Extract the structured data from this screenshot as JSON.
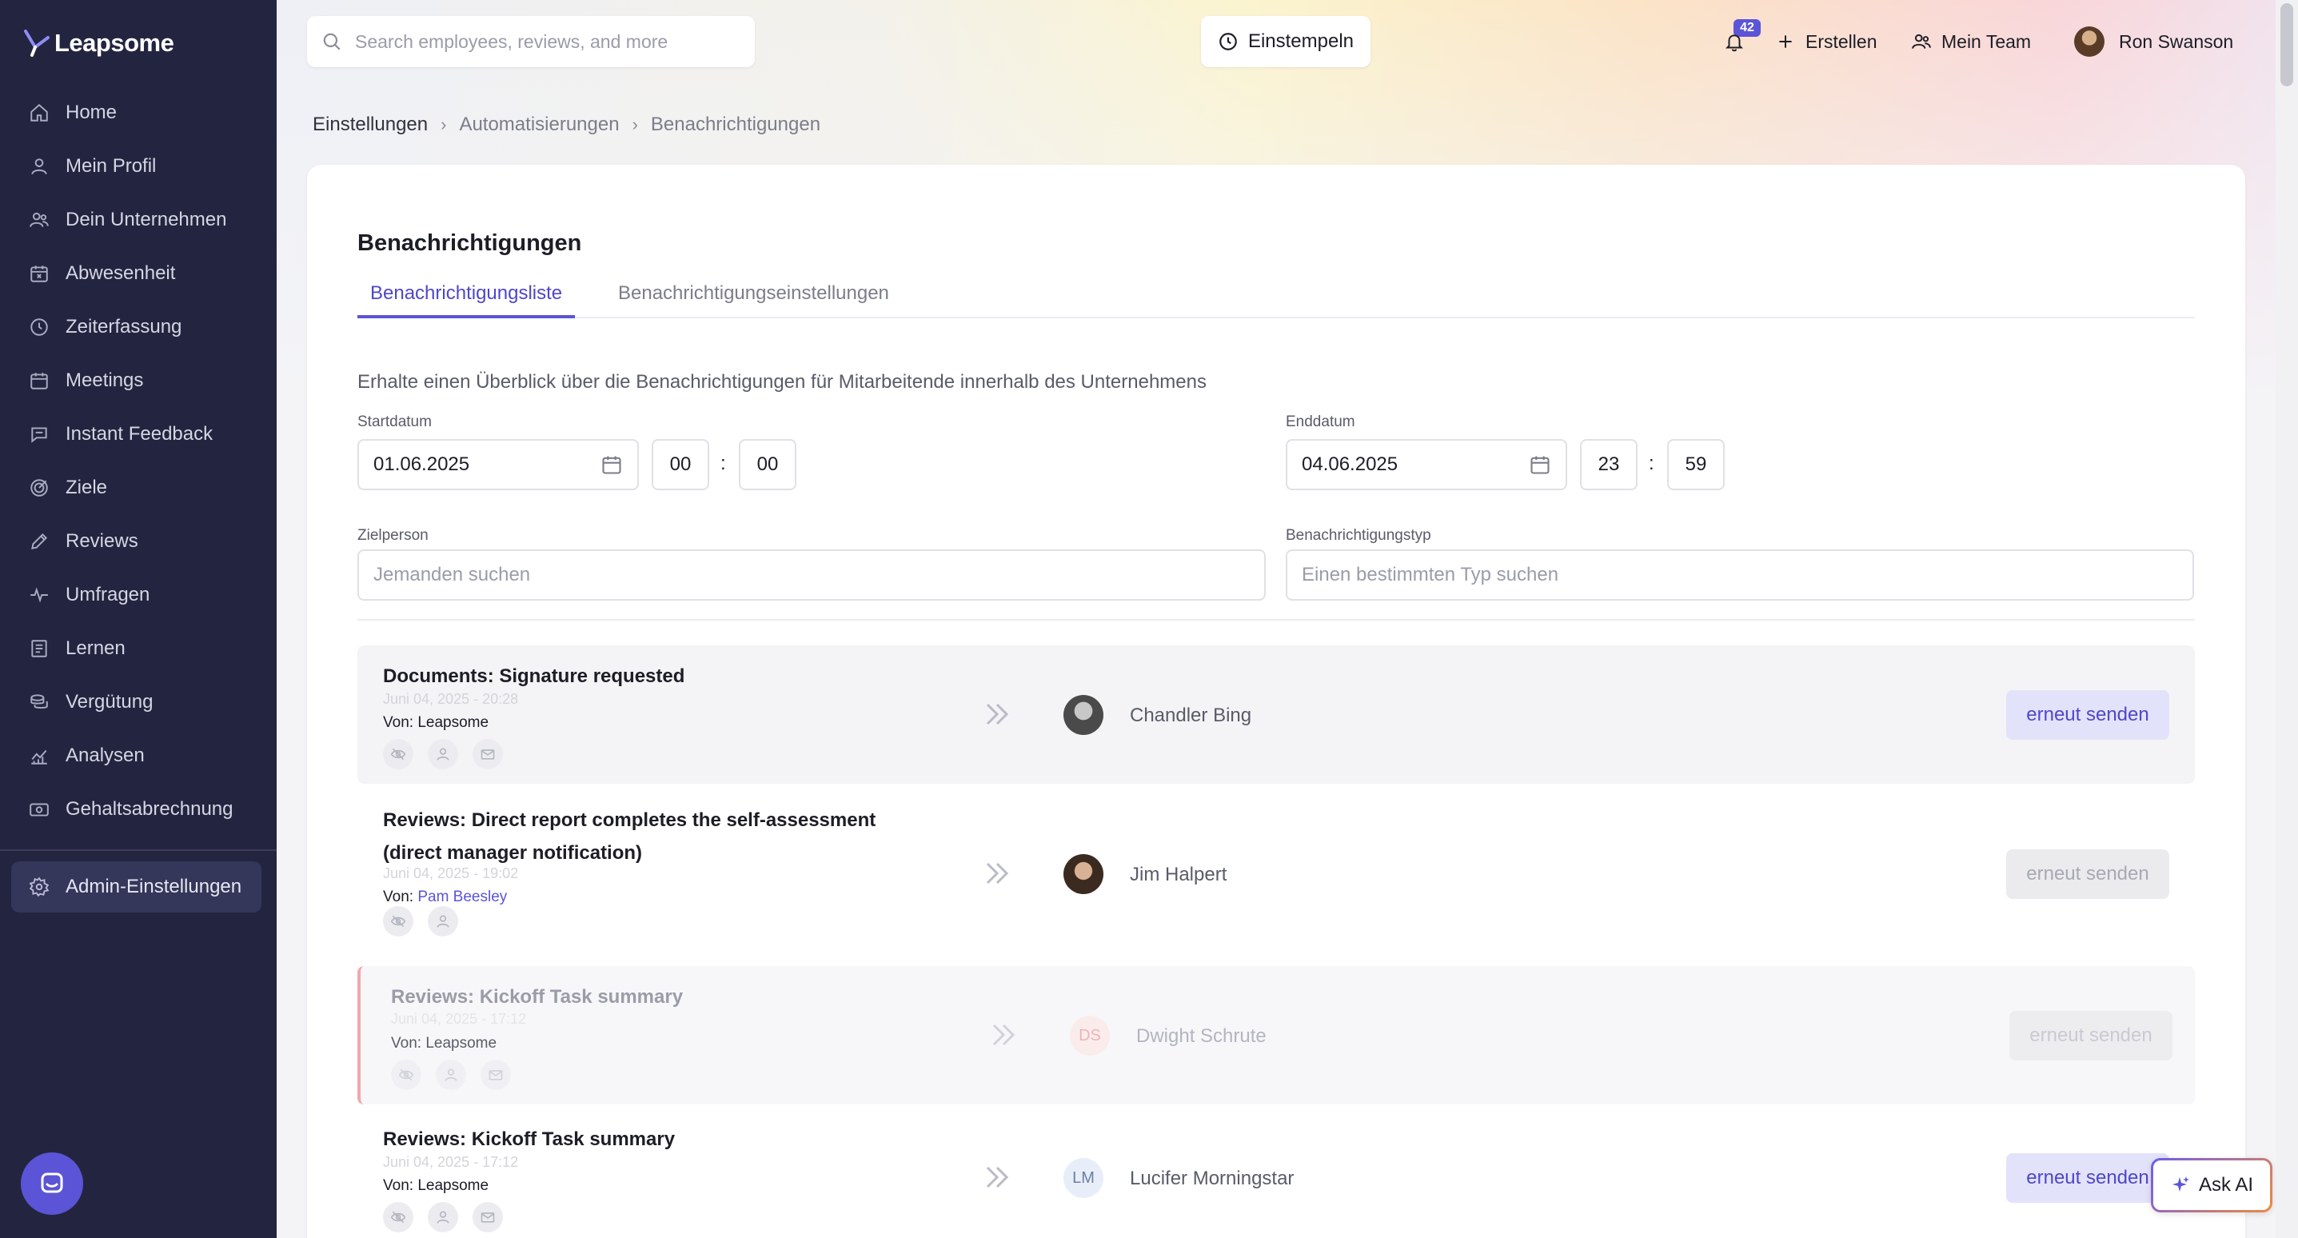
{
  "app": {
    "name": "Leapsome"
  },
  "sidebar": {
    "items": [
      {
        "label": "Home",
        "icon": "home-icon"
      },
      {
        "label": "Mein Profil",
        "icon": "user-icon"
      },
      {
        "label": "Dein Unternehmen",
        "icon": "users-icon"
      },
      {
        "label": "Abwesenheit",
        "icon": "calendar-x-icon"
      },
      {
        "label": "Zeiterfassung",
        "icon": "clock-icon"
      },
      {
        "label": "Meetings",
        "icon": "calendar-icon"
      },
      {
        "label": "Instant Feedback",
        "icon": "chat-icon"
      },
      {
        "label": "Ziele",
        "icon": "target-icon"
      },
      {
        "label": "Reviews",
        "icon": "pen-icon"
      },
      {
        "label": "Umfragen",
        "icon": "pulse-icon"
      },
      {
        "label": "Lernen",
        "icon": "book-icon"
      },
      {
        "label": "Vergütung",
        "icon": "coins-icon"
      },
      {
        "label": "Analysen",
        "icon": "chart-icon"
      },
      {
        "label": "Gehaltsabrechnung",
        "icon": "payroll-icon"
      }
    ],
    "admin": {
      "label": "Admin-Einstellungen",
      "icon": "gear-icon",
      "active": true
    }
  },
  "topbar": {
    "search_placeholder": "Search employees, reviews, and more",
    "clock_in_label": "Einstempeln",
    "notification_count": "42",
    "create_label": "Erstellen",
    "team_label": "Mein Team",
    "user_name": "Ron Swanson"
  },
  "breadcrumb": [
    "Einstellungen",
    "Automatisierungen",
    "Benachrichtigungen"
  ],
  "page": {
    "title": "Benachrichtigungen",
    "tabs": [
      {
        "label": "Benachrichtigungsliste",
        "active": true
      },
      {
        "label": "Benachrichtigungseinstellungen",
        "active": false
      }
    ],
    "description": "Erhalte einen Überblick über die Benachrichtigungen für Mitarbeitende innerhalb des Unternehmens"
  },
  "filters": {
    "start": {
      "label": "Startdatum",
      "date": "01.06.2025",
      "hour": "00",
      "minute": "00"
    },
    "end": {
      "label": "Enddatum",
      "date": "04.06.2025",
      "hour": "23",
      "minute": "59"
    },
    "target": {
      "label": "Zielperson",
      "placeholder": "Jemanden suchen"
    },
    "type": {
      "label": "Benachrichtigungstyp",
      "placeholder": "Einen bestimmten Typ suchen"
    }
  },
  "notifications": [
    {
      "title": "Documents: Signature requested",
      "date": "Juni 04, 2025 - 20:28",
      "from_prefix": "Von:",
      "from": "Leapsome",
      "recipient": "Chandler Bing",
      "initials": "",
      "resend": "erneut senden",
      "resend_enabled": true,
      "channels": [
        "hidden-eye",
        "person",
        "email"
      ]
    },
    {
      "title": "Reviews: Direct report completes the self-assessment (direct manager notification)",
      "date": "Juni 04, 2025 - 19:02",
      "from_prefix": "Von:",
      "from": "Pam Beesley",
      "recipient": "Jim Halpert",
      "initials": "",
      "resend": "erneut senden",
      "resend_enabled": false,
      "channels": [
        "hidden-eye",
        "person"
      ]
    },
    {
      "title": "Reviews: Kickoff Task summary",
      "date": "Juni 04, 2025 - 17:12",
      "from_prefix": "Von:",
      "from": "Leapsome",
      "recipient": "Dwight Schrute",
      "initials": "DS",
      "resend": "erneut senden",
      "resend_enabled": false,
      "channels": [
        "hidden-eye",
        "person",
        "email"
      ]
    },
    {
      "title": "Reviews: Kickoff Task summary",
      "date": "Juni 04, 2025 - 17:12",
      "from_prefix": "Von:",
      "from": "Leapsome",
      "recipient": "Lucifer Morningstar",
      "initials": "LM",
      "resend": "erneut senden",
      "resend_enabled": true,
      "channels": [
        "hidden-eye",
        "person",
        "email"
      ]
    }
  ],
  "ask_ai": {
    "label": "Ask AI"
  },
  "colors": {
    "sidebar": "#232540",
    "accent": "#5b54d6",
    "accent_light": "#e3e2fb"
  }
}
